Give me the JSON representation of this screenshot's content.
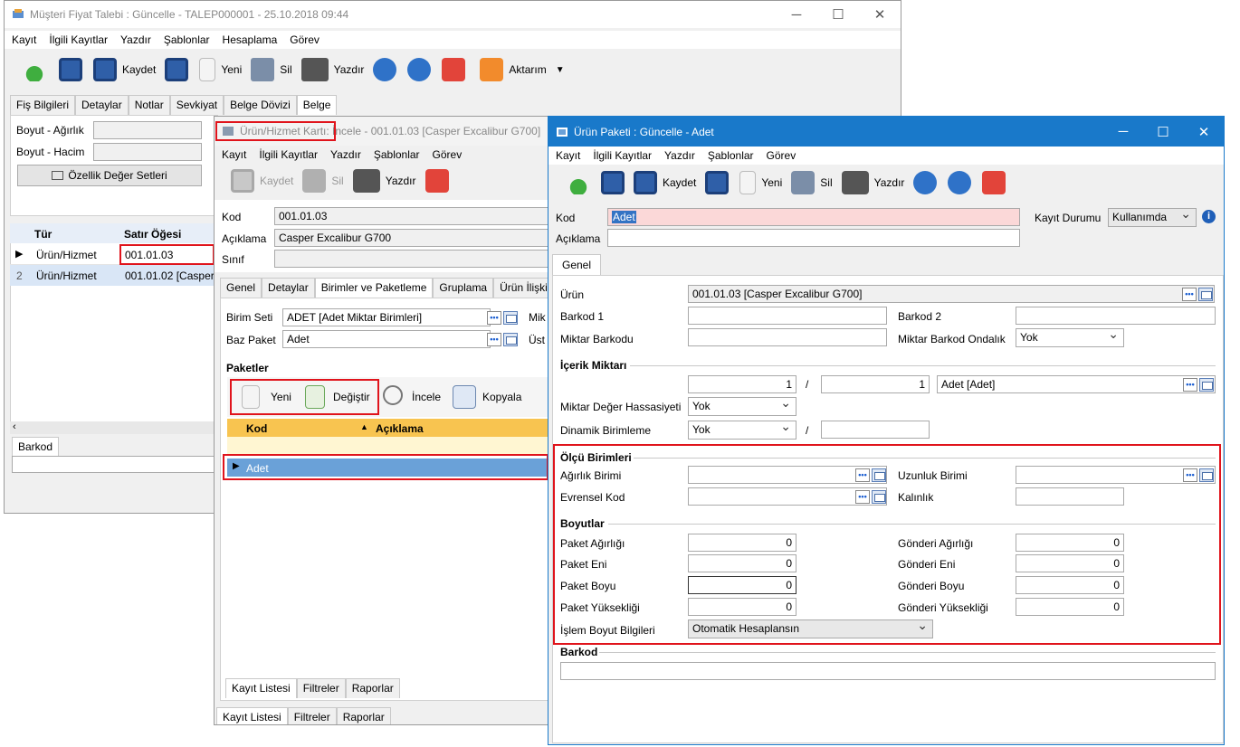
{
  "w1": {
    "title": "Müşteri Fiyat Talebi : Güncelle - TALEP000001 - 25.10.2018 09:44",
    "menu": [
      "Kayıt",
      "İlgili Kayıtlar",
      "Yazdır",
      "Şablonlar",
      "Hesaplama",
      "Görev"
    ],
    "toolbar": {
      "save": "Kaydet",
      "new": "Yeni",
      "delete": "Sil",
      "print": "Yazdır",
      "transfer": "Aktarım"
    },
    "tabs": [
      "Fiş Bilgileri",
      "Detaylar",
      "Notlar",
      "Sevkiyat",
      "Belge Dövizi",
      "Belge"
    ],
    "labels": {
      "weight": "Boyut - Ağırlık",
      "volume": "Boyut - Hacim",
      "props_btn": "Özellik Değer Setleri"
    },
    "grid": {
      "headers": [
        "Tür",
        "Satır Öğesi"
      ],
      "rows": [
        {
          "no": "",
          "type": "Ürün/Hizmet",
          "item": "001.01.03"
        },
        {
          "no": "2",
          "type": "Ürün/Hizmet",
          "item": "001.01.02 [Casper E"
        }
      ]
    },
    "barcode": "Barkod"
  },
  "w2": {
    "title_a": "Ürün/Hizmet Kartı",
    "title_b": " : İncele - 001.01.03 [Casper Excalibur G700]",
    "menu": [
      "Kayıt",
      "İlgili Kayıtlar",
      "Yazdır",
      "Şablonlar",
      "Görev"
    ],
    "toolbar": {
      "save": "Kaydet",
      "delete": "Sil",
      "print": "Yazdır"
    },
    "fields": {
      "kod_l": "Kod",
      "kod": "001.01.03",
      "aciklama_l": "Açıklama",
      "aciklama": "Casper Excalibur G700",
      "sinif_l": "Sınıf"
    },
    "tabs": [
      "Genel",
      "Detaylar",
      "Birimler ve Paketleme",
      "Gruplama",
      "Ürün İlişkiler"
    ],
    "birim": {
      "set_l": "Birim Seti",
      "set": "ADET [Adet Miktar Birimleri]",
      "baz_l": "Baz Paket",
      "baz": "Adet",
      "mik": "Mik",
      "ust": "Üst"
    },
    "paketler": "Paketler",
    "pk_toolbar": {
      "new": "Yeni",
      "change": "Değiştir",
      "inspect": "İncele",
      "copy": "Kopyala"
    },
    "grid": {
      "headers": [
        "Kod",
        "Açıklama"
      ],
      "row": "Adet"
    },
    "bottom_tabs": [
      "Kayıt Listesi",
      "Filtreler",
      "Raporlar"
    ]
  },
  "w3": {
    "title": "Ürün Paketi : Güncelle - Adet",
    "menu": [
      "Kayıt",
      "İlgili Kayıtlar",
      "Yazdır",
      "Şablonlar",
      "Görev"
    ],
    "toolbar": {
      "save": "Kaydet",
      "new": "Yeni",
      "delete": "Sil",
      "print": "Yazdır"
    },
    "kod_l": "Kod",
    "kod": "Adet",
    "aciklama_l": "Açıklama",
    "durum_l": "Kayıt Durumu",
    "durum": "Kullanımda",
    "tab": "Genel",
    "urun_l": "Ürün",
    "urun": "001.01.03 [Casper Excalibur G700]",
    "barkod1": "Barkod 1",
    "barkod2": "Barkod 2",
    "miktar_barkodu": "Miktar Barkodu",
    "miktar_barkod_ondalik": "Miktar Barkod Ondalık",
    "ondalik": "Yok",
    "icerik": "İçerik Miktarı",
    "q1": "1",
    "slash": "/",
    "q2": "1",
    "birim": "Adet [Adet]",
    "hassasiyet_l": "Miktar Değer Hassasiyeti",
    "hassasiyet": "Yok",
    "dinamik_l": "Dinamik Birimleme",
    "dinamik": "Yok",
    "olcu": "Ölçü Birimleri",
    "agirlik_birimi": "Ağırlık Birimi",
    "uzunluk_birimi": "Uzunluk Birimi",
    "evrensel_kod": "Evrensel Kod",
    "kalinlik": "Kalınlık",
    "boyutlar": "Boyutlar",
    "paket_agirligi": "Paket Ağırlığı",
    "paket_eni": "Paket Eni",
    "paket_boyu": "Paket Boyu",
    "paket_yuksekligi": "Paket Yüksekliği",
    "gonderi_agirligi": "Gönderi Ağırlığı",
    "gonderi_eni": "Gönderi Eni",
    "gonderi_boyu": "Gönderi Boyu",
    "gonderi_yuksekligi": "Gönderi Yüksekliği",
    "zero": "0",
    "islem_l": "İşlem Boyut Bilgileri",
    "islem": "Otomatik Hesaplansın",
    "barkod": "Barkod"
  },
  "colors": {
    "accent": "#1979ca",
    "highlight": "#e0141c",
    "selected_row": "#6aa1d8",
    "grid_header": "#f8c450"
  }
}
